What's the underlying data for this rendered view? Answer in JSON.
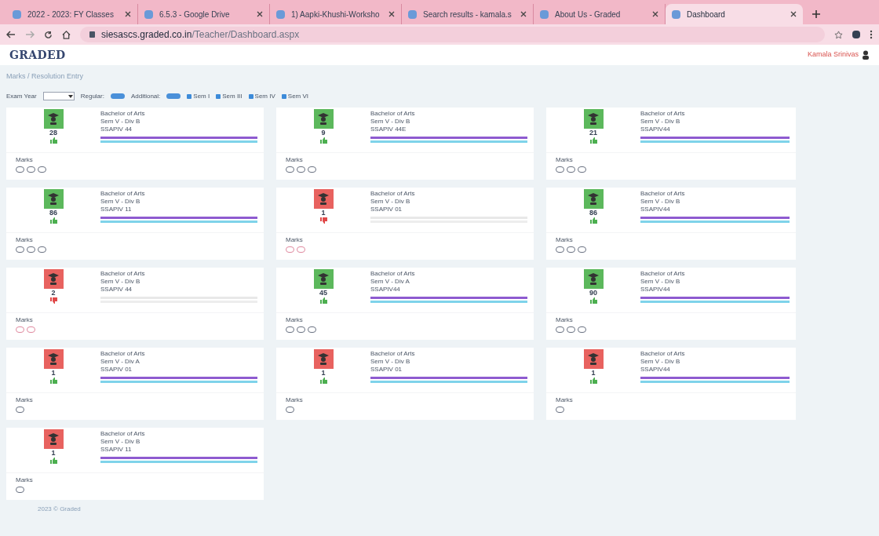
{
  "browser": {
    "tabs": [
      {
        "title": "2022 - 2023: FY Classes",
        "selected": false
      },
      {
        "title": "6.5.3 - Google Drive",
        "selected": false
      },
      {
        "title": "1) Aapki-Khushi-Worksho",
        "selected": false
      },
      {
        "title": "Search results - kamala.s",
        "selected": false
      },
      {
        "title": "About Us - Graded",
        "selected": false
      },
      {
        "title": "Dashboard",
        "selected": true
      }
    ],
    "url_host": "siesascs.graded.co.in",
    "url_path": "/Teacher/Dashboard.aspx"
  },
  "header": {
    "logo": "GRADED",
    "user": "Kamala Srinivas"
  },
  "breadcrumb": "Marks / Resolution Entry",
  "filters": {
    "exam_year_label": "Exam Year",
    "regular_label": "Regular:",
    "additional_label": "Additional:",
    "semesters": [
      {
        "label": "Sem I",
        "checked": true
      },
      {
        "label": "Sem III",
        "checked": true
      },
      {
        "label": "Sem IV",
        "checked": true
      },
      {
        "label": "Sem VI",
        "checked": true
      }
    ]
  },
  "cards": [
    {
      "passed": true,
      "thumbs_up": true,
      "count": "28",
      "program": "Bachelor of Arts",
      "division": "Sem V - Div B",
      "code": "SSAPIV 44",
      "bars_filled": true,
      "marks_label": "Marks",
      "buttons": [
        {
          "kind": "pill"
        },
        {
          "kind": "pill"
        },
        {
          "kind": "pill"
        }
      ]
    },
    {
      "passed": true,
      "thumbs_up": true,
      "count": "9",
      "program": "Bachelor of Arts",
      "division": "Sem V - Div B",
      "code": "SSAPIV 44E",
      "bars_filled": true,
      "marks_label": "Marks",
      "buttons": [
        {
          "kind": "pill"
        },
        {
          "kind": "pill"
        },
        {
          "kind": "pill"
        }
      ]
    },
    {
      "passed": true,
      "thumbs_up": true,
      "count": "21",
      "program": "Bachelor of Arts",
      "division": "Sem V - Div B",
      "code": "SSAPIV44",
      "bars_filled": true,
      "marks_label": "Marks",
      "buttons": [
        {
          "kind": "pill"
        },
        {
          "kind": "pill"
        },
        {
          "kind": "pill"
        }
      ]
    },
    {
      "passed": true,
      "thumbs_up": true,
      "count": "86",
      "program": "Bachelor of Arts",
      "division": "Sem V - Div B",
      "code": "SSAPIV 11",
      "bars_filled": true,
      "marks_label": "Marks",
      "buttons": [
        {
          "kind": "pill"
        },
        {
          "kind": "pill"
        },
        {
          "kind": "pill"
        }
      ]
    },
    {
      "passed": false,
      "thumbs_up": false,
      "count": "1",
      "program": "Bachelor of Arts",
      "division": "Sem V - Div B",
      "code": "SSAPIV 01",
      "bars_filled": false,
      "marks_label": "Marks",
      "buttons": [
        {
          "kind": "pill"
        },
        {
          "kind": "pill"
        }
      ]
    },
    {
      "passed": true,
      "thumbs_up": true,
      "count": "86",
      "program": "Bachelor of Arts",
      "division": "Sem V - Div B",
      "code": "SSAPIV44",
      "bars_filled": true,
      "marks_label": "Marks",
      "buttons": [
        {
          "kind": "pill"
        },
        {
          "kind": "pill"
        },
        {
          "kind": "pill"
        }
      ]
    },
    {
      "passed": false,
      "thumbs_up": false,
      "count": "2",
      "program": "Bachelor of Arts",
      "division": "Sem V - Div B",
      "code": "SSAPIV 44",
      "bars_filled": false,
      "marks_label": "Marks",
      "buttons": [
        {
          "kind": "pill"
        },
        {
          "kind": "pill"
        }
      ]
    },
    {
      "passed": true,
      "thumbs_up": true,
      "count": "45",
      "program": "Bachelor of Arts",
      "division": "Sem V - Div A",
      "code": "SSAPIV44",
      "bars_filled": true,
      "marks_label": "Marks",
      "buttons": [
        {
          "kind": "pill"
        },
        {
          "kind": "pill"
        },
        {
          "kind": "pill"
        }
      ]
    },
    {
      "passed": true,
      "thumbs_up": true,
      "count": "90",
      "program": "Bachelor of Arts",
      "division": "Sem V - Div B",
      "code": "SSAPIV44",
      "bars_filled": true,
      "marks_label": "Marks",
      "buttons": [
        {
          "kind": "pill"
        },
        {
          "kind": "pill"
        },
        {
          "kind": "pill"
        }
      ]
    },
    {
      "passed": false,
      "thumbs_up": true,
      "count": "1",
      "program": "Bachelor of Arts",
      "division": "Sem V - Div A",
      "code": "SSAPIV 01",
      "bars_filled": true,
      "marks_label": "Marks",
      "buttons": [
        {
          "kind": "pill"
        }
      ]
    },
    {
      "passed": false,
      "thumbs_up": true,
      "count": "1",
      "program": "Bachelor of Arts",
      "division": "Sem V - Div B",
      "code": "SSAPIV 01",
      "bars_filled": true,
      "marks_label": "Marks",
      "buttons": [
        {
          "kind": "pill"
        }
      ]
    },
    {
      "passed": false,
      "thumbs_up": true,
      "count": "1",
      "program": "Bachelor of Arts",
      "division": "Sem V - Div B",
      "code": "SSAPIV44",
      "bars_filled": true,
      "marks_label": "Marks",
      "buttons": [
        {
          "kind": "pill"
        }
      ]
    },
    {
      "passed": false,
      "thumbs_up": true,
      "count": "1",
      "program": "Bachelor of Arts",
      "division": "Sem V - Div B",
      "code": "SSAPIV 11",
      "bars_filled": true,
      "marks_label": "Marks",
      "buttons": [
        {
          "kind": "pill"
        }
      ]
    }
  ],
  "footer": "2023 © Graded"
}
